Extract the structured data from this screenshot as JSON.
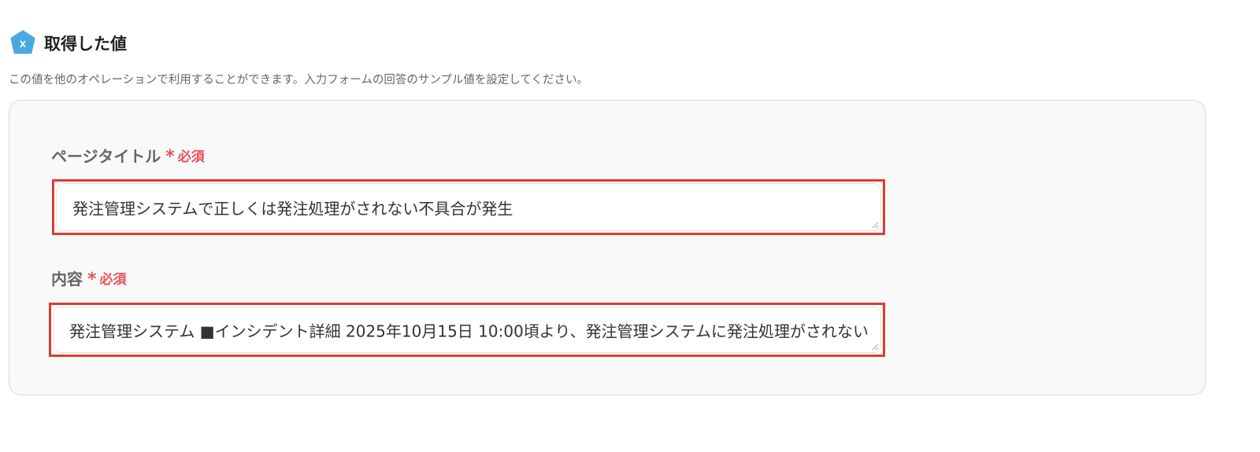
{
  "header": {
    "icon": "variable-x-icon",
    "icon_glyph": "x",
    "icon_color": "#4aa8e0",
    "title": "取得した値"
  },
  "description": "この値を他のオペレーションで利用することができます。入力フォームの回答のサンプル値を設定してください。",
  "fields": [
    {
      "label": "ページタイトル",
      "required_mark": "*",
      "required_text": "必須",
      "value": "発注管理システムで正しくは発注処理がされない不具合が発生"
    },
    {
      "label": "内容",
      "required_mark": "*",
      "required_text": "必須",
      "value": "発注管理システム ■インシデント詳細 2025年10月15日 10:00頃より、発注管理システムに発注処理がされない"
    }
  ],
  "colors": {
    "accent_red": "#e8515b",
    "highlight_border": "#e03a2f",
    "panel_bg": "#f9f9f9"
  }
}
